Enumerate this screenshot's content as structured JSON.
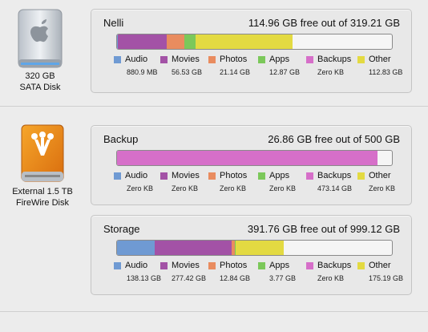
{
  "categories": [
    {
      "key": "audio",
      "name": "Audio",
      "color": "#6f9ad3"
    },
    {
      "key": "movies",
      "name": "Movies",
      "color": "#a352a6"
    },
    {
      "key": "photos",
      "name": "Photos",
      "color": "#e98c5f"
    },
    {
      "key": "apps",
      "name": "Apps",
      "color": "#7bc85a"
    },
    {
      "key": "backups",
      "name": "Backups",
      "color": "#d66fc9"
    },
    {
      "key": "other",
      "name": "Other",
      "color": "#e3da42"
    }
  ],
  "disks": [
    {
      "id": "sata",
      "icon": "internal-disk-icon",
      "line1": "320 GB",
      "line2": "SATA Disk"
    },
    {
      "id": "firewire",
      "icon": "firewire-disk-icon",
      "line1": "External 1.5 TB",
      "line2": "FireWire Disk"
    }
  ],
  "volumes": [
    {
      "name": "Nelli",
      "free_text": "114.96 GB free out of 319.21 GB",
      "capacity_gb": 319.21,
      "sizes": [
        "880.9 MB",
        "56.53 GB",
        "21.14 GB",
        "12.87 GB",
        "Zero KB",
        "112.83 GB"
      ],
      "gb": [
        0.86,
        56.53,
        21.14,
        12.87,
        0,
        112.83
      ]
    },
    {
      "name": "Backup",
      "free_text": "26.86 GB free out of 500 GB",
      "capacity_gb": 500,
      "sizes": [
        "Zero KB",
        "Zero KB",
        "Zero KB",
        "Zero KB",
        "473.14 GB",
        "Zero KB"
      ],
      "gb": [
        0,
        0,
        0,
        0,
        473.14,
        0
      ]
    },
    {
      "name": "Storage",
      "free_text": "391.76 GB free out of 999.12 GB",
      "capacity_gb": 999.12,
      "sizes": [
        "138.13 GB",
        "277.42 GB",
        "12.84 GB",
        "3.77 GB",
        "Zero KB",
        "175.19 GB"
      ],
      "gb": [
        138.13,
        277.42,
        12.84,
        3.77,
        0,
        175.19
      ]
    }
  ]
}
